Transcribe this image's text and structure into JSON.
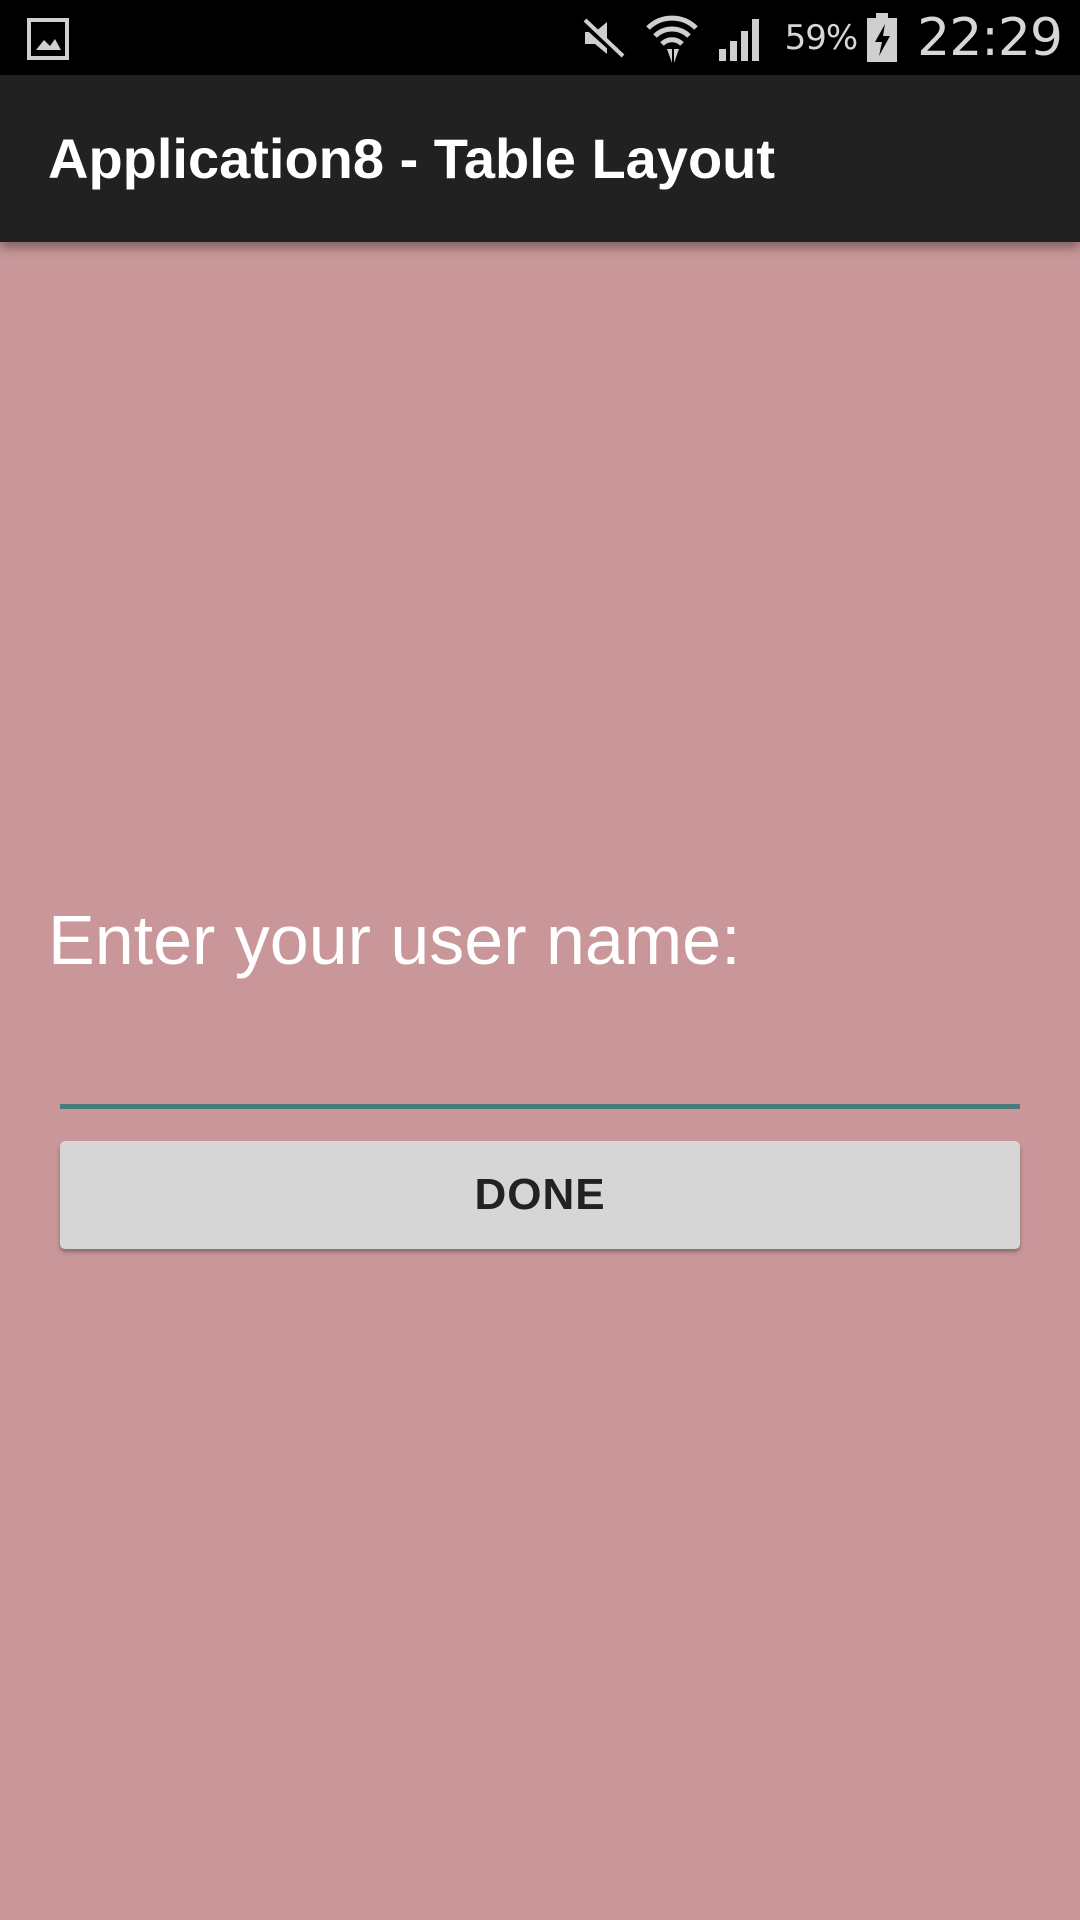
{
  "status_bar": {
    "icons": [
      "gallery-icon",
      "mute-icon",
      "wifi-icon",
      "signal-icon",
      "battery-charging-icon"
    ],
    "battery_percent": "59%",
    "time": "22:29"
  },
  "action_bar": {
    "title": "Application8 - Table Layout"
  },
  "form": {
    "prompt": "Enter your user name:",
    "username_value": "",
    "done_label": "DONE"
  },
  "colors": {
    "background": "#c9979a",
    "action_bar": "#212121",
    "status_bar": "#000000",
    "input_underline": "#4b7a7c",
    "button": "#d6d6d6"
  }
}
